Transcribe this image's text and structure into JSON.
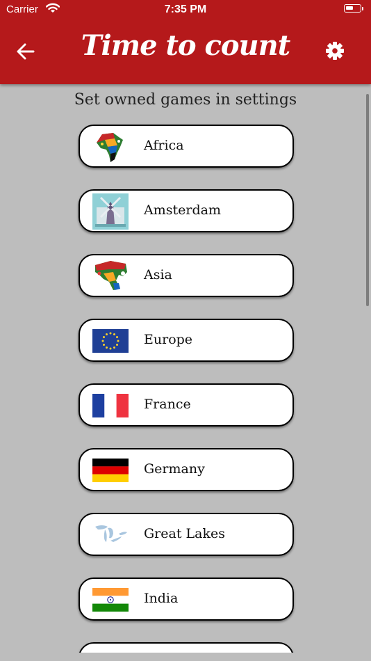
{
  "status_bar": {
    "carrier": "Carrier",
    "time": "7:35 PM",
    "battery_level": 0.55
  },
  "header": {
    "title": "Time to count",
    "back_icon": "arrow-left-icon",
    "settings_icon": "gear-icon"
  },
  "hint": "Set owned games in settings",
  "games": [
    {
      "label": "Africa",
      "icon": "africa-flags-map-icon"
    },
    {
      "label": "Amsterdam",
      "icon": "amsterdam-windmill-icon"
    },
    {
      "label": "Asia",
      "icon": "asia-flags-map-icon"
    },
    {
      "label": "Europe",
      "icon": "eu-flag-icon"
    },
    {
      "label": "France",
      "icon": "france-flag-icon"
    },
    {
      "label": "Germany",
      "icon": "germany-flag-icon"
    },
    {
      "label": "Great Lakes",
      "icon": "great-lakes-map-icon"
    },
    {
      "label": "India",
      "icon": "india-flag-icon"
    },
    {
      "label": "",
      "icon": "italy-flag-icon"
    }
  ],
  "colors": {
    "header": "#b5191b",
    "background": "#bdbdbd"
  }
}
